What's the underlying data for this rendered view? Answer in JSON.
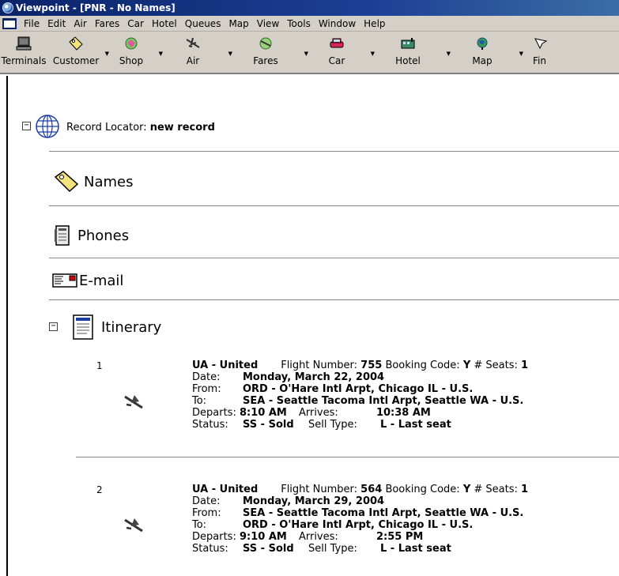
{
  "window": {
    "title": "Viewpoint - [PNR - No Names]"
  },
  "menu": [
    "File",
    "Edit",
    "Air",
    "Fares",
    "Car",
    "Hotel",
    "Queues",
    "Map",
    "View",
    "Tools",
    "Window",
    "Help"
  ],
  "toolbar": [
    {
      "label": "Terminals",
      "icon": "terminal-icon"
    },
    {
      "label": "Customer",
      "icon": "customer-tag-icon"
    },
    {
      "label": "Shop",
      "icon": "shop-icon"
    },
    {
      "label": "Air",
      "icon": "plane-icon"
    },
    {
      "label": "Fares",
      "icon": "fares-icon"
    },
    {
      "label": "Car",
      "icon": "car-icon"
    },
    {
      "label": "Hotel",
      "icon": "hotel-icon"
    },
    {
      "label": "Map",
      "icon": "globe-icon"
    },
    {
      "label": "Fin",
      "icon": "find-icon"
    }
  ],
  "record": {
    "label": "Record Locator:",
    "value": "new record"
  },
  "sections": {
    "names": "Names",
    "phones": "Phones",
    "email": "E-mail",
    "itinerary": "Itinerary"
  },
  "labels": {
    "date": "Date:",
    "from": "From:",
    "to": "To:",
    "departs": "Departs:",
    "arrives": "Arrives:",
    "status": "Status:",
    "sell_type": "Sell Type:",
    "flight_number": "Flight Number:",
    "booking_code": "Booking Code:",
    "seats": "# Seats:"
  },
  "segments": [
    {
      "num": "1",
      "airline": "UA - United",
      "flight": "755",
      "booking": "Y",
      "seats": "1",
      "date": "Monday, March 22, 2004",
      "from": "ORD - O'Hare Intl Arpt, Chicago IL - U.S.",
      "to": "SEA - Seattle Tacoma Intl Arpt, Seattle WA - U.S.",
      "departs": "8:10 AM",
      "arrives": "10:38 AM",
      "status": "SS - Sold",
      "sell_type": "L - Last seat"
    },
    {
      "num": "2",
      "airline": "UA - United",
      "flight": "564",
      "booking": "Y",
      "seats": "1",
      "date": "Monday, March 29, 2004",
      "from": "SEA - Seattle Tacoma Intl Arpt, Seattle WA - U.S.",
      "to": "ORD - O'Hare Intl Arpt, Chicago IL - U.S.",
      "departs": "9:10 AM",
      "arrives": "2:55 PM",
      "status": "SS - Sold",
      "sell_type": "L - Last seat"
    }
  ],
  "expander_collapse_symbol": "−"
}
